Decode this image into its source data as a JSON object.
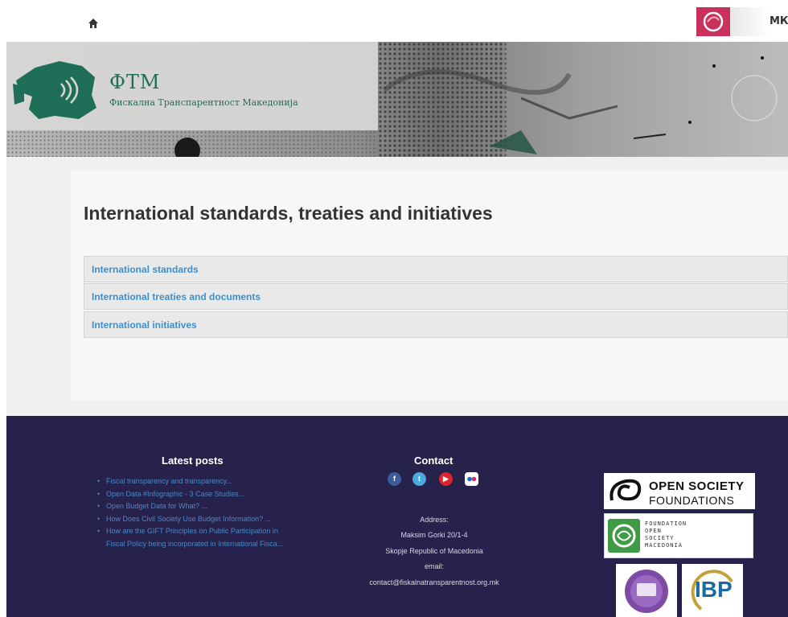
{
  "header": {
    "home_icon": "home-icon",
    "language_label": "МК"
  },
  "banner": {
    "logo_title": "ФТМ",
    "logo_subtitle": "Фискална Транспарентност Македонија"
  },
  "main": {
    "page_title": "International standards, treaties and initiatives",
    "accordion": [
      {
        "label": "International standards"
      },
      {
        "label": "International treaties and documents"
      },
      {
        "label": "International initiatives"
      }
    ]
  },
  "footer": {
    "latest_posts": {
      "heading": "Latest posts",
      "items": [
        "Fiscal transparency and transparency...",
        "Open Data #Infographic - 3 Case Studies...",
        "Open Budget Data for What? ...",
        "How Does Civil Society Use Budget Information? ...",
        "How are the GIFT Principles on Public Participation in Fiscal Policy being incorporated in International Fisca..."
      ]
    },
    "contact": {
      "heading": "Contact",
      "social_icons": [
        "facebook-icon",
        "twitter-icon",
        "youtube-icon",
        "flickr-icon"
      ],
      "address_label": "Address:",
      "street": "Maksim Gorki 20/1-4",
      "city": "Skopje Republic of Macedonia",
      "email_label": "email:",
      "email": "contact@fiskalnatransparentnost.org.mk"
    },
    "partners": {
      "osf_line1": "OPEN SOCIETY",
      "osf_line2": "FOUNDATIONS",
      "fosm_lines": [
        "FOUNDATION",
        "OPEN",
        "SOCIETY",
        "MACEDONIA"
      ],
      "ibp_text": "IBP"
    }
  },
  "colors": {
    "footer_bg": "#26224c",
    "link_blue": "#3d8fce",
    "brand_green": "#1f6e58",
    "accent_pink": "#c9305b"
  }
}
